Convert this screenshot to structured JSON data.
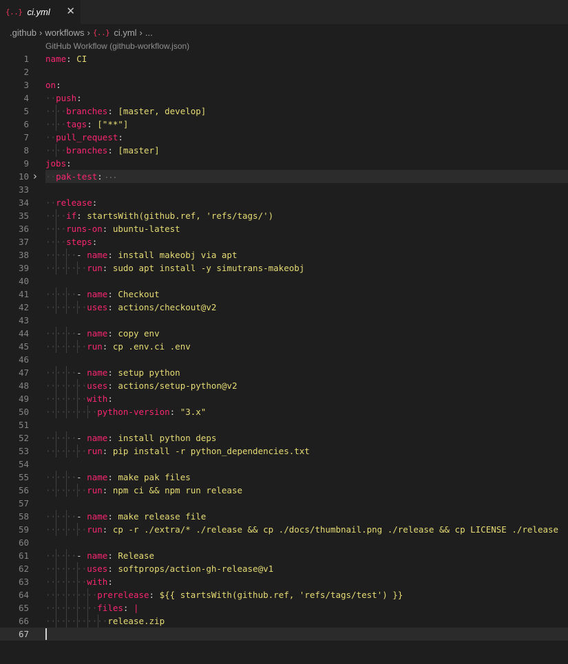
{
  "tab": {
    "icon": "json-icon",
    "label": "ci.yml",
    "close_icon": "close-icon"
  },
  "breadcrumb": [
    ".github",
    "workflows",
    "ci.yml",
    "..."
  ],
  "schema_hint": "GitHub Workflow (github-workflow.json)",
  "colors": {
    "key": "#f92672",
    "string": "#e6db74",
    "text": "#d4d4d4",
    "line_number": "#858585",
    "accent_icon": "#e8385a"
  },
  "editor": {
    "current_line": 67,
    "folded_line": 10,
    "lines": [
      {
        "n": "1",
        "i": 0,
        "k": "name",
        "s": ": ",
        "v": "CI"
      },
      {
        "n": "2",
        "i": 0
      },
      {
        "n": "3",
        "i": 0,
        "k": "on",
        "s": ":"
      },
      {
        "n": "4",
        "i": 2,
        "k": "push",
        "s": ":"
      },
      {
        "n": "5",
        "i": 4,
        "k": "branches",
        "s": ": ",
        "v": "[master, develop]"
      },
      {
        "n": "6",
        "i": 4,
        "k": "tags",
        "s": ": ",
        "v": "[\"**\"]"
      },
      {
        "n": "7",
        "i": 2,
        "k": "pull_request",
        "s": ":"
      },
      {
        "n": "8",
        "i": 4,
        "k": "branches",
        "s": ": ",
        "v": "[master]"
      },
      {
        "n": "9",
        "i": 0,
        "k": "jobs",
        "s": ":"
      },
      {
        "n": "10",
        "i": 2,
        "k": "pak-test",
        "s": ":",
        "fold": true
      },
      {
        "n": "33",
        "i": 0
      },
      {
        "n": "34",
        "i": 2,
        "k": "release",
        "s": ":"
      },
      {
        "n": "35",
        "i": 4,
        "k": "if",
        "s": ": ",
        "v": "startsWith(github.ref, 'refs/tags/')"
      },
      {
        "n": "36",
        "i": 4,
        "k": "runs-on",
        "s": ": ",
        "v": "ubuntu-latest"
      },
      {
        "n": "37",
        "i": 4,
        "k": "steps",
        "s": ":"
      },
      {
        "n": "38",
        "i": 6,
        "d": "- ",
        "k": "name",
        "s": ": ",
        "v": "install makeobj via apt"
      },
      {
        "n": "39",
        "i": 8,
        "k": "run",
        "s": ": ",
        "v": "sudo apt install -y simutrans-makeobj"
      },
      {
        "n": "40",
        "i": 0
      },
      {
        "n": "41",
        "i": 6,
        "d": "- ",
        "k": "name",
        "s": ": ",
        "v": "Checkout"
      },
      {
        "n": "42",
        "i": 8,
        "k": "uses",
        "s": ": ",
        "v": "actions/checkout@v2"
      },
      {
        "n": "43",
        "i": 0
      },
      {
        "n": "44",
        "i": 6,
        "d": "- ",
        "k": "name",
        "s": ": ",
        "v": "copy env"
      },
      {
        "n": "45",
        "i": 8,
        "k": "run",
        "s": ": ",
        "v": "cp .env.ci .env"
      },
      {
        "n": "46",
        "i": 0
      },
      {
        "n": "47",
        "i": 6,
        "d": "- ",
        "k": "name",
        "s": ": ",
        "v": "setup python"
      },
      {
        "n": "48",
        "i": 8,
        "k": "uses",
        "s": ": ",
        "v": "actions/setup-python@v2"
      },
      {
        "n": "49",
        "i": 8,
        "k": "with",
        "s": ":"
      },
      {
        "n": "50",
        "i": 10,
        "k": "python-version",
        "s": ": ",
        "v": "\"3.x\""
      },
      {
        "n": "51",
        "i": 0
      },
      {
        "n": "52",
        "i": 6,
        "d": "- ",
        "k": "name",
        "s": ": ",
        "v": "install python deps"
      },
      {
        "n": "53",
        "i": 8,
        "k": "run",
        "s": ": ",
        "v": "pip install -r python_dependencies.txt"
      },
      {
        "n": "54",
        "i": 0
      },
      {
        "n": "55",
        "i": 6,
        "d": "- ",
        "k": "name",
        "s": ": ",
        "v": "make pak files"
      },
      {
        "n": "56",
        "i": 8,
        "k": "run",
        "s": ": ",
        "v": "npm ci && npm run release"
      },
      {
        "n": "57",
        "i": 0
      },
      {
        "n": "58",
        "i": 6,
        "d": "- ",
        "k": "name",
        "s": ": ",
        "v": "make release file"
      },
      {
        "n": "59",
        "i": 8,
        "k": "run",
        "s": ": ",
        "v": "cp -r ./extra/* ./release && cp ./docs/thumbnail.png ./release && cp LICENSE ./release"
      },
      {
        "n": "60",
        "i": 0
      },
      {
        "n": "61",
        "i": 6,
        "d": "- ",
        "k": "name",
        "s": ": ",
        "v": "Release"
      },
      {
        "n": "62",
        "i": 8,
        "k": "uses",
        "s": ": ",
        "v": "softprops/action-gh-release@v1"
      },
      {
        "n": "63",
        "i": 8,
        "k": "with",
        "s": ":"
      },
      {
        "n": "64",
        "i": 10,
        "k": "prerelease",
        "s": ": ",
        "v": "${{ startsWith(github.ref, 'refs/tags/test') }}"
      },
      {
        "n": "65",
        "i": 10,
        "k": "files",
        "s": ": ",
        "v": "|"
      },
      {
        "n": "66",
        "i": 12,
        "v": "release.zip"
      },
      {
        "n": "67",
        "i": 0
      }
    ]
  }
}
